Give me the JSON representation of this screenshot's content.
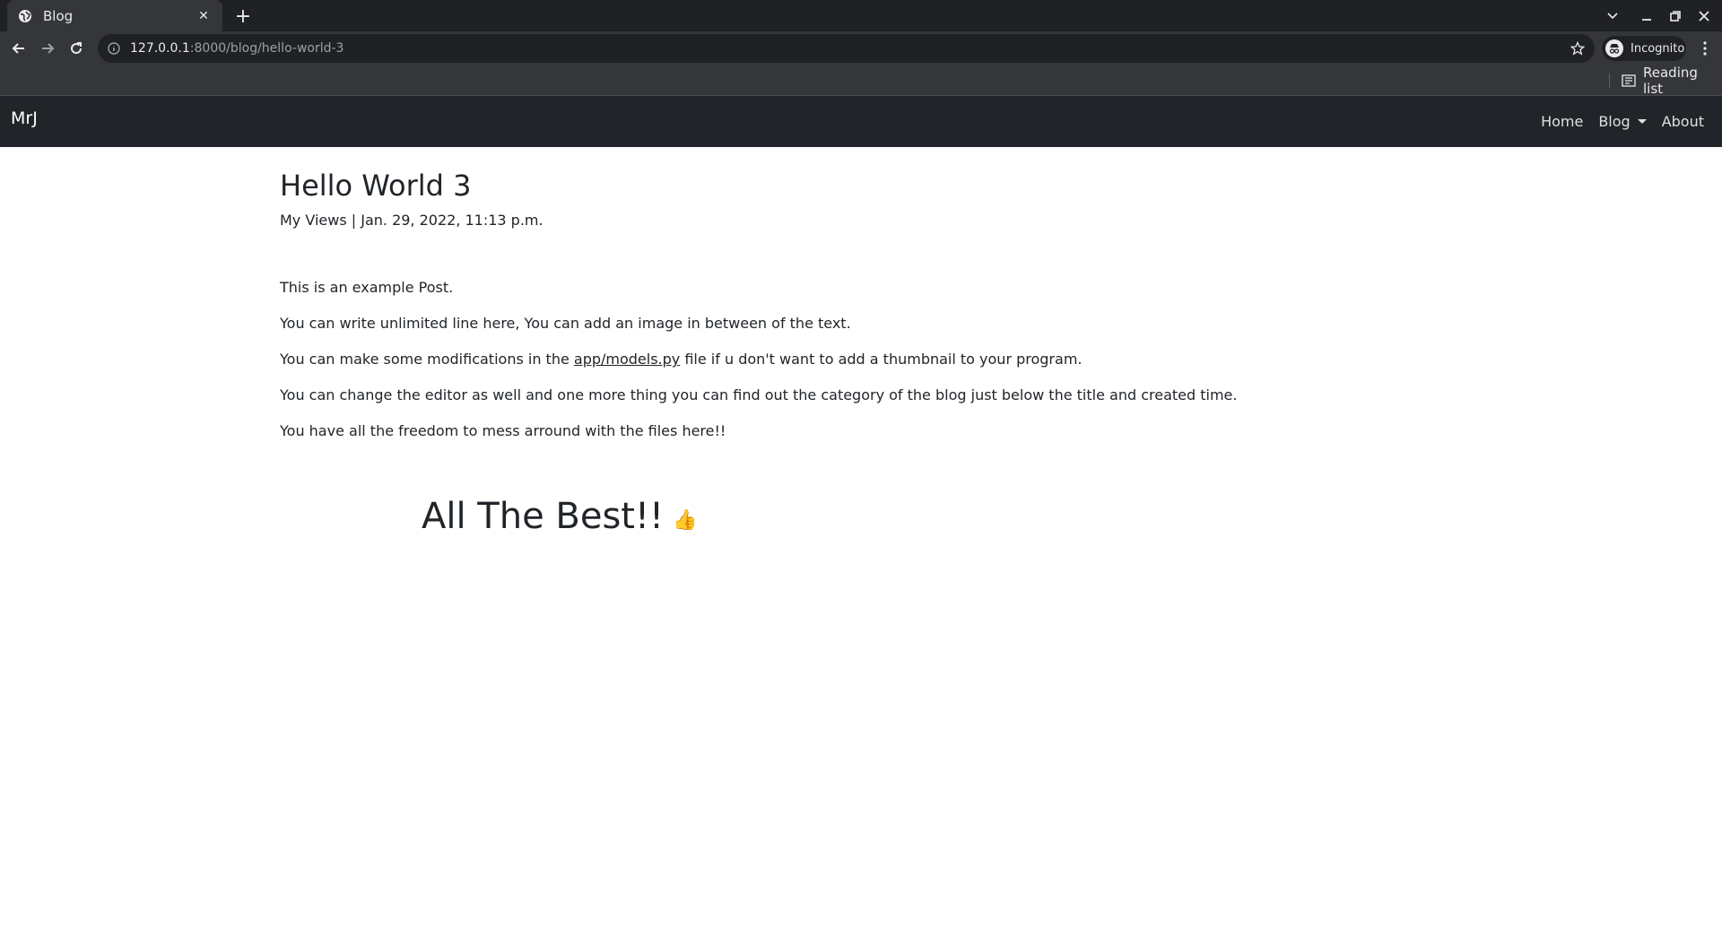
{
  "browser": {
    "tab": {
      "title": "Blog"
    },
    "address": {
      "host": "127.0.0.1",
      "path": ":8000/blog/hello-world-3"
    },
    "profile": {
      "label": "Incognito"
    },
    "bookmarks": {
      "reading_list": "Reading list"
    }
  },
  "site": {
    "brand": "MrJ",
    "nav": {
      "home": "Home",
      "blog": "Blog",
      "about": "About"
    }
  },
  "post": {
    "title": "Hello World 3",
    "meta": "My Views | Jan. 29, 2022, 11:13 p.m.",
    "p1": "This is an example Post.",
    "p2": "You can write unlimited line here, You can add an image in between of the text.",
    "p3_before": "You can make some modifications in the ",
    "p3_link": "app/models.py",
    "p3_after": " file if u don't want to add a thumbnail to your program.",
    "p4": "You can change the editor as well and one more thing you can find out the category of the blog just below the title and created time.",
    "p5": "You have all the freedom to mess arround with the files here!!",
    "closing": "All The Best!!",
    "closing_emoji": "👍"
  }
}
